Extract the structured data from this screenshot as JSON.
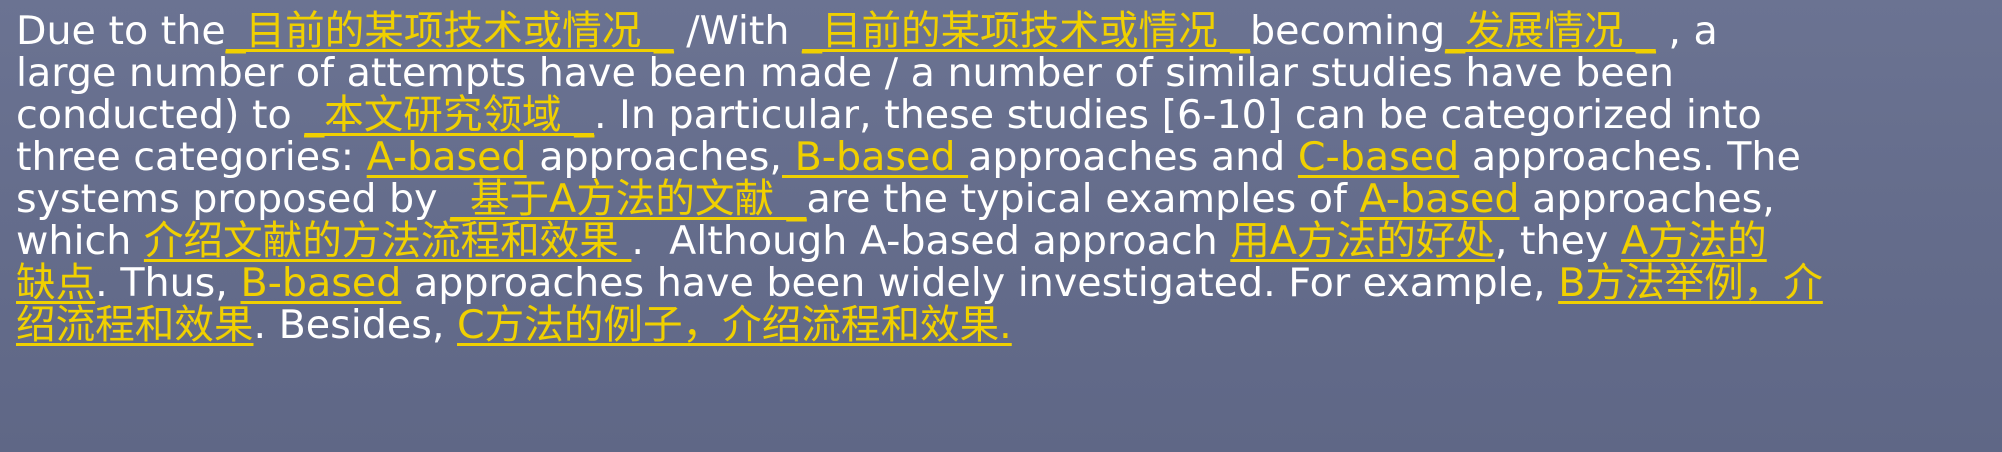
{
  "lines": [
    [
      {
        "text": "Due to the",
        "style": "t"
      },
      {
        "text": "_目前的某项技术或情况 _",
        "style": "y"
      },
      {
        "text": " /With ",
        "style": "t"
      },
      {
        "text": "_目前的某项技术或情况 _",
        "style": "y"
      },
      {
        "text": "becoming",
        "style": "t"
      },
      {
        "text": "_发展情况 _",
        "style": "y"
      },
      {
        "text": " , a",
        "style": "t"
      }
    ],
    [
      {
        "text": "large number of attempts have been made / a number of similar studies have been",
        "style": "t"
      }
    ],
    [
      {
        "text": "conducted) to ",
        "style": "t"
      },
      {
        "text": "_本文研究领域 _",
        "style": "y"
      },
      {
        "text": ". In particular, these studies [6-10] can be categorized into",
        "style": "t"
      }
    ],
    [
      {
        "text": "three categories: ",
        "style": "t"
      },
      {
        "text": "A-based",
        "style": "y"
      },
      {
        "text": " approaches,",
        "style": "t"
      },
      {
        "text": " B-based ",
        "style": "y"
      },
      {
        "text": "approaches and ",
        "style": "t"
      },
      {
        "text": "C-based",
        "style": "y"
      },
      {
        "text": " approaches. The",
        "style": "t"
      }
    ],
    [
      {
        "text": "systems proposed by ",
        "style": "t"
      },
      {
        "text": "_基于A方法的文献 _",
        "style": "y"
      },
      {
        "text": "are the typical examples of ",
        "style": "t"
      },
      {
        "text": "A-based",
        "style": "y"
      },
      {
        "text": " approaches,",
        "style": "t"
      }
    ],
    [
      {
        "text": "which ",
        "style": "t"
      },
      {
        "text": "介绍文献的方法流程和效果 ",
        "style": "y"
      },
      {
        "text": ".  Although A-based approach ",
        "style": "t"
      },
      {
        "text": "用A方法的好处",
        "style": "y"
      },
      {
        "text": ", they ",
        "style": "t"
      },
      {
        "text": "A方法的",
        "style": "y"
      }
    ],
    [
      {
        "text": "缺点",
        "style": "y"
      },
      {
        "text": ". Thus, ",
        "style": "t"
      },
      {
        "text": "B-based",
        "style": "y"
      },
      {
        "text": " approaches have been widely investigated. For example, ",
        "style": "t"
      },
      {
        "text": "B方法举例，介",
        "style": "y"
      }
    ],
    [
      {
        "text": "绍流程和效果",
        "style": "y"
      },
      {
        "text": ". Besides, ",
        "style": "t"
      },
      {
        "text": "C方法的例子，介绍流程和效果.",
        "style": "y"
      }
    ]
  ]
}
